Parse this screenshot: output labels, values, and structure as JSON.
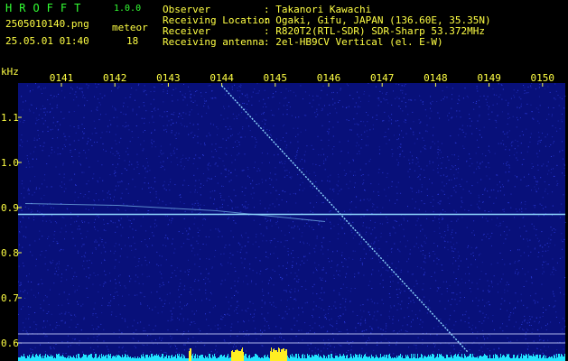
{
  "header": {
    "app_title": "HROFFT",
    "app_version": "1.0.0",
    "filename": "2505010140.png",
    "datetime": "25.05.01 01:40",
    "meteor_label": "meteor",
    "meteor_count": "18",
    "info": [
      {
        "key": "Observer",
        "value": ": Takanori Kawachi"
      },
      {
        "key": "Receiving Location",
        "value": ": Ogaki, Gifu, JAPAN (136.60E, 35.35N)"
      },
      {
        "key": "Receiver",
        "value": ": R820T2(RTL-SDR) SDR-Sharp 53.372MHz"
      },
      {
        "key": "Receiving antenna",
        "value": ": 2el-HB9CV Vertical (el. E-W)"
      }
    ]
  },
  "chart_data": {
    "type": "heatmap",
    "y_unit": "kHz",
    "x_ticks": [
      "0141",
      "0142",
      "0143",
      "0144",
      "0145",
      "0146",
      "0147",
      "0148",
      "0149",
      "0150"
    ],
    "y_ticks": [
      "1.1",
      "1.0",
      "0.9",
      "0.8",
      "0.7",
      "0.6"
    ],
    "ylim": [
      0.58,
      1.2
    ],
    "signals": {
      "horizontal_carrier_khz": 0.885,
      "reference_lines_khz": [
        0.62,
        0.6
      ],
      "diagonal_trace": {
        "start": [
          "0144",
          1.17
        ],
        "end": [
          "0148.6",
          0.58
        ]
      }
    },
    "colors": {
      "background": "#08107a",
      "noise": "#3a4cff",
      "signal": "#8fd8ff",
      "reference_line": "#c8d0ff",
      "bottom_power": "#22e4ff",
      "bottom_peak": "#ffee22"
    }
  }
}
